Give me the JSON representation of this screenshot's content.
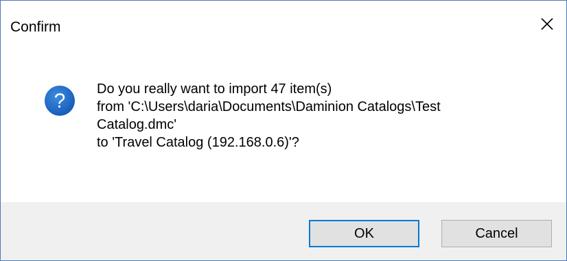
{
  "window": {
    "title": "Confirm"
  },
  "message": {
    "lines": [
      "Do you really want to import 47 item(s)",
      "from 'C:\\Users\\daria\\Documents\\Daminion Catalogs\\Test",
      "Catalog.dmc'",
      "to 'Travel Catalog (192.168.0.6)'?"
    ]
  },
  "icons": {
    "message_icon": "question-icon",
    "close_icon": "close-icon"
  },
  "buttons": {
    "ok_label": "OK",
    "cancel_label": "Cancel"
  },
  "colors": {
    "icon_blue": "#1b6ac9",
    "focus_border": "#0078d7",
    "footer_bg": "#f0f0f0"
  }
}
